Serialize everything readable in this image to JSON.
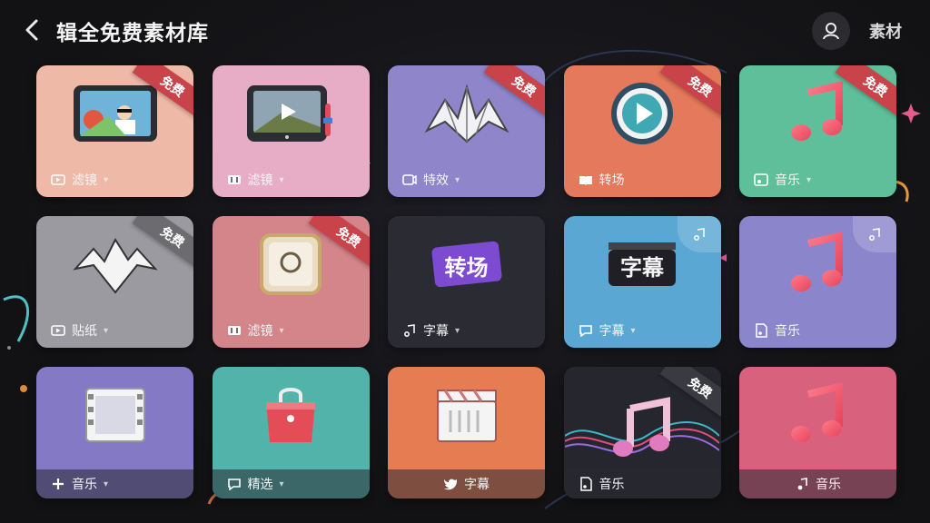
{
  "header": {
    "title": "辑全免费素材库",
    "more_label": "素材"
  },
  "colors": {
    "background": "#141416",
    "ribbon": "#c8434a"
  },
  "cards": [
    {
      "id": "video",
      "bg": "#efb9a8",
      "badge": "免费",
      "icon": "tablet-video-icon",
      "label_icon": "video-icon",
      "label": "滤镜",
      "chevron": true
    },
    {
      "id": "filter",
      "bg": "#e7adc6",
      "badge": "",
      "icon": "tablet-play-icon",
      "label_icon": "film-icon",
      "label": "滤镜",
      "chevron": true
    },
    {
      "id": "effects",
      "bg": "#8f85cb",
      "badge": "免费",
      "icon": "crystal-mountain-icon",
      "label_icon": "effects-icon",
      "label": "特效",
      "chevron": true
    },
    {
      "id": "transitions",
      "bg": "#e5795b",
      "badge": "免费",
      "icon": "play-circle-icon",
      "label_icon": "book-icon",
      "label": "转场",
      "chevron": false
    },
    {
      "id": "music-green",
      "bg": "#5fbf9b",
      "badge": "免费",
      "icon": "music-note-icon",
      "label_icon": "music-box-icon",
      "label": "音乐",
      "chevron": true
    },
    {
      "id": "sticker",
      "bg": "#9a9aa0",
      "badge": "免费",
      "icon": "mountain-icon",
      "label_icon": "video-icon",
      "label": "贴纸",
      "chevron": true
    },
    {
      "id": "frame",
      "bg": "#d48589",
      "badge": "免费",
      "icon": "frame-icon",
      "label_icon": "film-icon",
      "label": "滤镜",
      "chevron": true
    },
    {
      "id": "text-template",
      "bg": "#2b2b33",
      "badge": "",
      "icon": "sparkle-text-icon",
      "tile_text": "转场",
      "label_icon": "note-icon",
      "label": "字幕",
      "chevron": true
    },
    {
      "id": "subtitle",
      "bg": "#5aa7d4",
      "badge": "",
      "icon": "caption-box-icon",
      "tile_text": "字幕",
      "label_icon": "chat-icon",
      "label": "字幕",
      "chevron": true
    },
    {
      "id": "music-purple",
      "bg": "#8b86cc",
      "badge": "",
      "icon": "music-note-icon",
      "label_icon": "music-doc-icon",
      "label": "音乐",
      "chevron": false
    },
    {
      "id": "clip",
      "bg": "#8479c4",
      "badge": "",
      "icon": "film-strip-icon",
      "label_icon": "plus-icon",
      "label": "音乐",
      "chevron": true
    },
    {
      "id": "shop",
      "bg": "#52b3ab",
      "badge": "",
      "icon": "shopping-bag-icon",
      "label_icon": "chat-icon",
      "label": "精选",
      "chevron": true
    },
    {
      "id": "subtitle-orange",
      "bg": "#e67c52",
      "badge": "",
      "icon": "clapper-icon",
      "label_icon": "twitter-icon",
      "label": "字幕",
      "chevron": false
    },
    {
      "id": "music-wave",
      "bg": "#26262e",
      "badge": "免费",
      "icon": "music-wave-icon",
      "label_icon": "music-doc-icon",
      "label": "音乐",
      "chevron": false
    },
    {
      "id": "music-pink",
      "bg": "#d8627d",
      "badge": "",
      "icon": "music-note-icon",
      "label_icon": "music-small-icon",
      "label": "音乐",
      "chevron": false
    }
  ]
}
